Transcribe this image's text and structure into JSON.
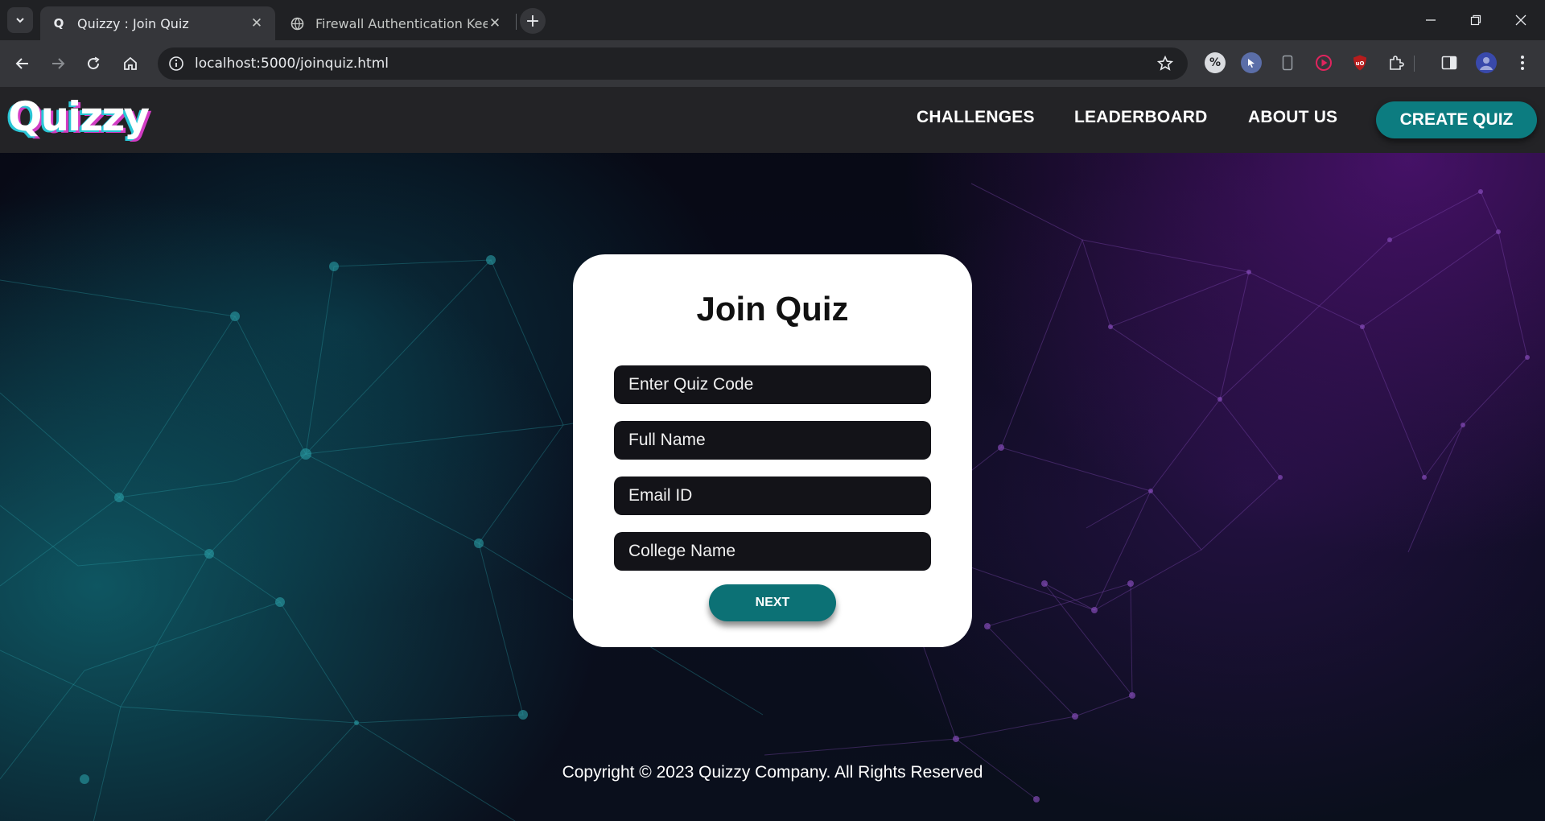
{
  "browser": {
    "tabs": [
      {
        "title": "Quizzy : Join Quiz",
        "favicon": "Q"
      },
      {
        "title": "Firewall Authentication Keepalive"
      }
    ],
    "url": "localhost:5000/joinquiz.html"
  },
  "navbar": {
    "logo": "Quizzy",
    "links": [
      "CHALLENGES",
      "LEADERBOARD",
      "ABOUT US"
    ],
    "cta": "CREATE QUIZ"
  },
  "form": {
    "title": "Join Quiz",
    "fields": [
      {
        "placeholder": "Enter Quiz Code",
        "value": ""
      },
      {
        "placeholder": "Full Name",
        "value": ""
      },
      {
        "placeholder": "Email ID",
        "value": ""
      },
      {
        "placeholder": "College Name",
        "value": ""
      }
    ],
    "submit_label": "NEXT"
  },
  "footer": {
    "text": "Copyright © 2023 Quizzy Company. All Rights Reserved"
  },
  "colors": {
    "accent": "#0c7c80",
    "navbar_bg": "#232326",
    "card_bg": "#ffffff",
    "field_bg": "#131318"
  }
}
